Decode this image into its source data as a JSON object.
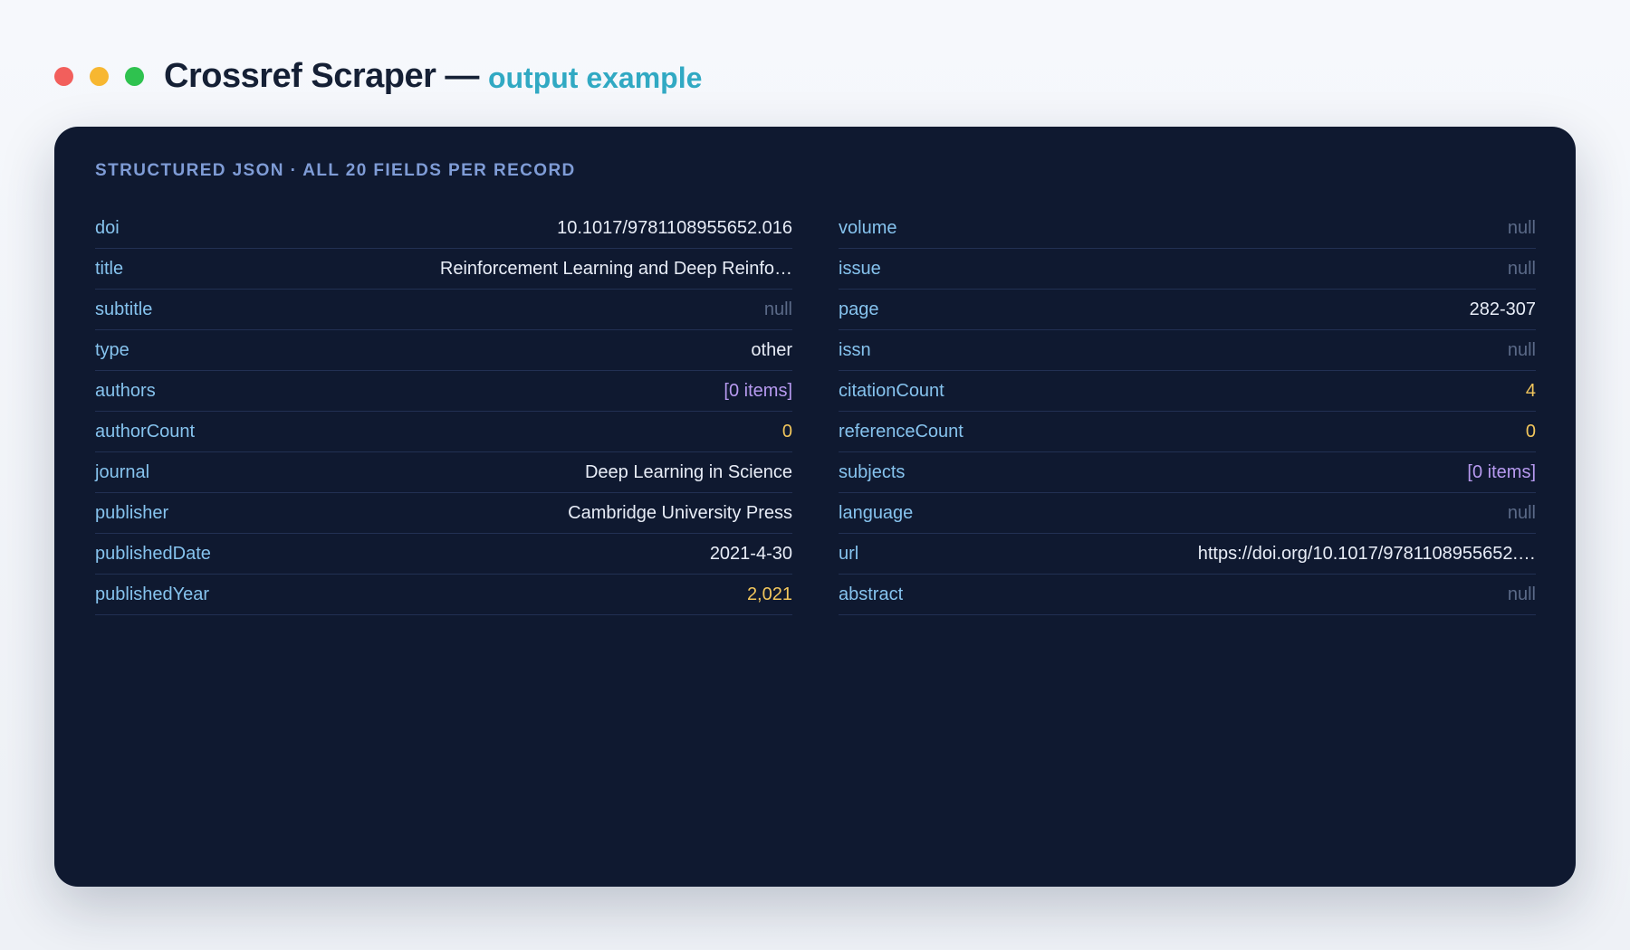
{
  "window": {
    "title": "Crossref Scraper —",
    "subtitle": "output example",
    "traffic_lights": [
      "#f25f5c",
      "#f7b731",
      "#2fc24f"
    ]
  },
  "panel": {
    "heading": "STRUCTURED JSON · ALL 20 FIELDS PER RECORD"
  },
  "left_fields": [
    {
      "key": "doi",
      "value": "10.1017/9781108955652.016",
      "kind": "string"
    },
    {
      "key": "title",
      "value": "Reinforcement Learning and Deep Reinfo…",
      "kind": "string"
    },
    {
      "key": "subtitle",
      "value": "null",
      "kind": "null"
    },
    {
      "key": "type",
      "value": "other",
      "kind": "string"
    },
    {
      "key": "authors",
      "value": "[0 items]",
      "kind": "array"
    },
    {
      "key": "authorCount",
      "value": "0",
      "kind": "number"
    },
    {
      "key": "journal",
      "value": "Deep Learning in Science",
      "kind": "string"
    },
    {
      "key": "publisher",
      "value": "Cambridge University Press",
      "kind": "string"
    },
    {
      "key": "publishedDate",
      "value": "2021-4-30",
      "kind": "string"
    },
    {
      "key": "publishedYear",
      "value": "2,021",
      "kind": "number"
    }
  ],
  "right_fields": [
    {
      "key": "volume",
      "value": "null",
      "kind": "null"
    },
    {
      "key": "issue",
      "value": "null",
      "kind": "null"
    },
    {
      "key": "page",
      "value": "282-307",
      "kind": "string"
    },
    {
      "key": "issn",
      "value": "null",
      "kind": "null"
    },
    {
      "key": "citationCount",
      "value": "4",
      "kind": "number"
    },
    {
      "key": "referenceCount",
      "value": "0",
      "kind": "number"
    },
    {
      "key": "subjects",
      "value": "[0 items]",
      "kind": "array"
    },
    {
      "key": "language",
      "value": "null",
      "kind": "null"
    },
    {
      "key": "url",
      "value": "https://doi.org/10.1017/9781108955652.…",
      "kind": "string"
    },
    {
      "key": "abstract",
      "value": "null",
      "kind": "null"
    }
  ],
  "colors": {
    "key": "#86c3ee",
    "string": "#e8edf7",
    "null": "#5b6a88",
    "number": "#f2c65c",
    "array": "#b79af0",
    "panel_bg": "#0f1930",
    "accent": "#31a9c3"
  }
}
